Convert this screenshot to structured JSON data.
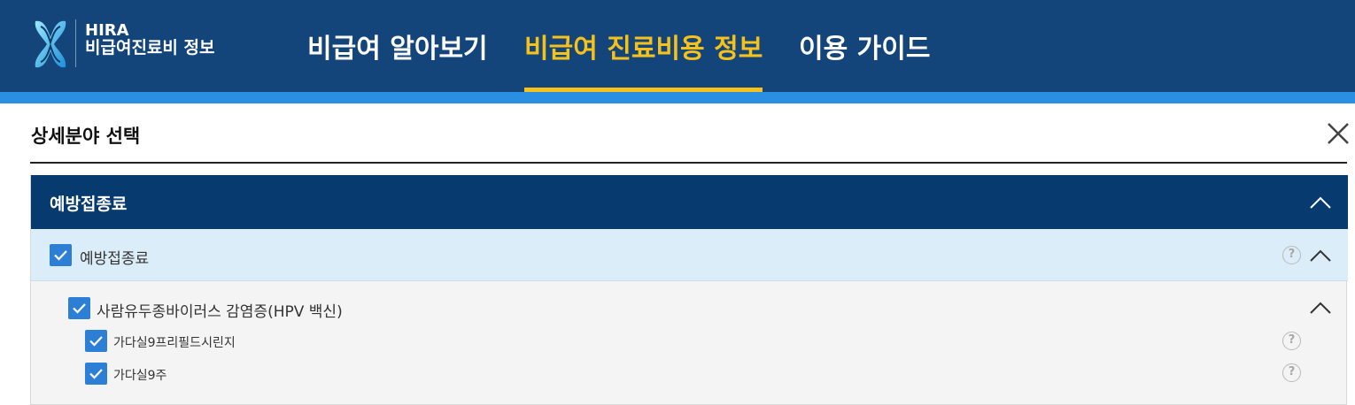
{
  "logo": {
    "line1": "HIRA",
    "line2": "비급여진료비 정보"
  },
  "nav": [
    {
      "label": "비급여 알아보기"
    },
    {
      "label": "비급여 진료비용 정보"
    },
    {
      "label": "이용 가이드"
    }
  ],
  "section_title": "상세분야 선택",
  "panel": {
    "category": "예방접종료",
    "group": {
      "label": "예방접종료",
      "checked": true
    },
    "subgroup": {
      "label": "사람유두종바이러스 감염증(HPV 백신)",
      "checked": true
    },
    "items": [
      {
        "label": "가다실9프리필드시린지",
        "checked": true
      },
      {
        "label": "가다실9주",
        "checked": true
      }
    ],
    "help_glyph": "?"
  },
  "colors": {
    "header": "#14457a",
    "header_stripe": "#2a8fe3",
    "nav_active": "#f6c21a",
    "panel_header": "#073a6e",
    "row_highlight": "#dcedfa",
    "checkbox": "#2d7fd6"
  }
}
